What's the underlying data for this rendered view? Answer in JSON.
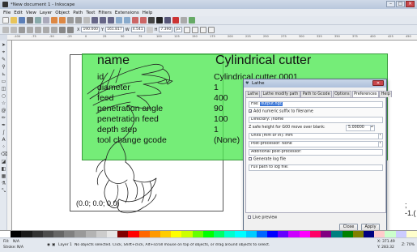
{
  "window": {
    "title": "*New document 1 - Inkscape",
    "buttons": [
      "–",
      "□",
      "×"
    ]
  },
  "menu": [
    "File",
    "Edit",
    "View",
    "Layer",
    "Object",
    "Path",
    "Text",
    "Filters",
    "Extensions",
    "Help"
  ],
  "control_bar": {
    "x": "190.000",
    "y": "161.817",
    "w": "4.541",
    "h": "7.390",
    "unit": "px"
  },
  "ruler": {
    "ticks": [
      "-100",
      "-75",
      "-50",
      "-25",
      "0",
      "25",
      "50",
      "75",
      "100",
      "125",
      "150",
      "175",
      "200",
      "225",
      "250",
      "275",
      "300",
      "325",
      "350",
      "375",
      "400",
      "425",
      "450"
    ]
  },
  "canvas": {
    "table": {
      "header_label": "name",
      "header_value": "Cylindrical cutter",
      "rows": [
        {
          "label": "id",
          "value": "Cylindrical cutter 0001"
        },
        {
          "label": "diameter",
          "value": "1"
        },
        {
          "label": "feed",
          "value": "400"
        },
        {
          "label": "penetration angle",
          "value": "90"
        },
        {
          "label": "penetration feed",
          "value": "100"
        },
        {
          "label": "depth step",
          "value": "1"
        },
        {
          "label": "tool change gcode",
          "value": "(None)"
        }
      ]
    },
    "coord_left": "(0.0; 0.0; 0.0)",
    "coord_right": "; -1.("
  },
  "dialog": {
    "title": "Lathe",
    "tabs": [
      "Lathe",
      "Lathe modify path",
      "Path to Gcode",
      "Options",
      "Preferences",
      "Help"
    ],
    "active_tab": "Preferences",
    "file_label": "File:",
    "file_value": "output.ngc",
    "add_suffix": "Add numeric suffix to filename",
    "directory_label": "Directory:",
    "directory_value": "/home",
    "zsafe_label": "Z safe height for G00 move over blank:",
    "zsafe_value": "5.00000",
    "units_label": "Units (mm or in):",
    "units_value": "mm",
    "postproc_label": "Post-processor:",
    "postproc_value": "None",
    "addpost_label": "Additional post-processor:",
    "genlog_label": "Generate log file",
    "fullpath_label": "Full path to log file:",
    "live_preview": "Live preview",
    "close": "Close",
    "apply": "Apply"
  },
  "palette_colors": [
    "#ffffff",
    "#000000",
    "#1a1a1a",
    "#333333",
    "#4d4d4d",
    "#666666",
    "#808080",
    "#999999",
    "#b3b3b3",
    "#cccccc",
    "#e6e6e6",
    "#800000",
    "#ff0000",
    "#ff6600",
    "#ff9900",
    "#ffcc00",
    "#ffff00",
    "#ccff00",
    "#66ff00",
    "#00ff00",
    "#00ff66",
    "#00ffcc",
    "#00ffff",
    "#00ccff",
    "#0066ff",
    "#0000ff",
    "#6600ff",
    "#cc00ff",
    "#ff00ff",
    "#ff0066",
    "#800080",
    "#008080",
    "#008000",
    "#808000",
    "#000080",
    "#ffcccc",
    "#ccffcc",
    "#ccccff",
    "#ffffcc"
  ],
  "status": {
    "fill_label": "Fill:",
    "fill_value": "N/A",
    "stroke_label": "Stroke:",
    "stroke_value": "N/A",
    "layer": "Layer 1",
    "message": "No objects selected. Click, Shift+click, Alt+scroll mouse on top of objects, or drag around objects to select.",
    "x_coord": "X: 371.49",
    "y_coord": "Y: 283.32",
    "zoom": "Z: 70%"
  }
}
